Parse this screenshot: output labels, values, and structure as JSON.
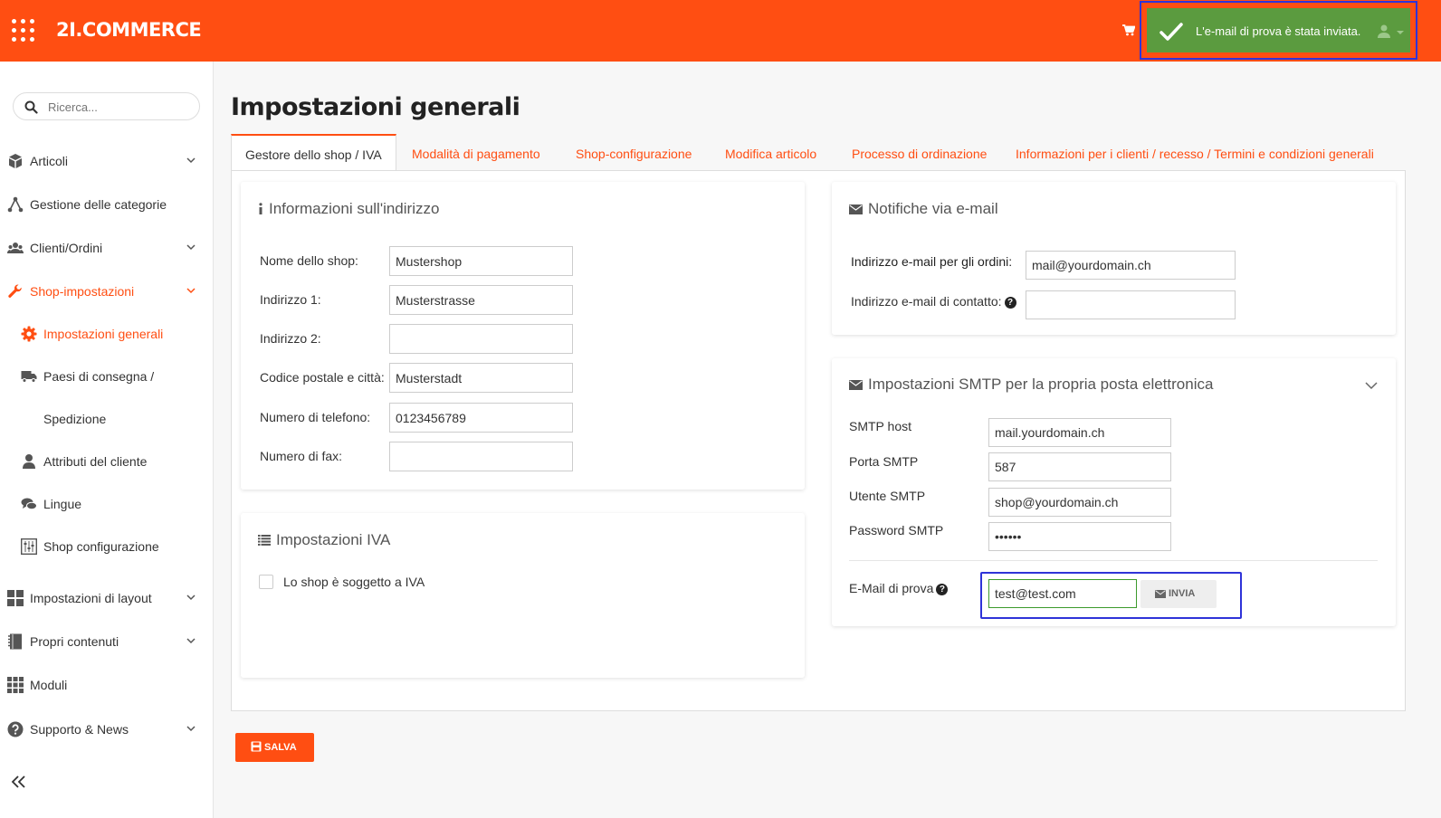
{
  "header": {
    "logo": "2I.COMMERCE",
    "toast_message": "L'e-mail di prova è stata inviata."
  },
  "sidebar": {
    "search_placeholder": "Ricerca...",
    "items": [
      {
        "label": "Articoli",
        "icon": "box-icon"
      },
      {
        "label": "Gestione delle categorie",
        "icon": "sitemap-icon"
      },
      {
        "label": "Clienti/Ordini",
        "icon": "users-icon"
      },
      {
        "label": "Shop-impostazioni",
        "icon": "wrench-icon"
      },
      {
        "label": "Impostazioni generali",
        "icon": "gear-icon"
      },
      {
        "label": "Paesi di consegna /",
        "icon": "truck-icon"
      },
      {
        "label": "Spedizione"
      },
      {
        "label": "Attributi del cliente",
        "icon": "user-icon"
      },
      {
        "label": "Lingue",
        "icon": "comments-icon"
      },
      {
        "label": "Shop configurazione",
        "icon": "sliders-icon"
      },
      {
        "label": "Impostazioni di layout",
        "icon": "grid-icon"
      },
      {
        "label": "Propri contenuti",
        "icon": "book-icon"
      },
      {
        "label": "Moduli",
        "icon": "modules-icon"
      },
      {
        "label": "Supporto & News",
        "icon": "help-icon"
      }
    ]
  },
  "page": {
    "title": "Impostazioni generali"
  },
  "tabs": [
    "Gestore dello shop / IVA",
    "Modalità di pagamento",
    "Shop-configurazione",
    "Modifica articolo",
    "Processo di ordinazione",
    "Informazioni per i clienti / recesso / Termini e condizioni generali"
  ],
  "address": {
    "title": "Informazioni sull'indirizzo",
    "fields": [
      {
        "label": "Nome dello shop:",
        "value": "Mustershop"
      },
      {
        "label": "Indirizzo 1:",
        "value": "Musterstrasse"
      },
      {
        "label": "Indirizzo 2:",
        "value": ""
      },
      {
        "label": "Codice postale e città:",
        "value": "Musterstadt"
      },
      {
        "label": "Numero di telefono:",
        "value": "0123456789"
      },
      {
        "label": "Numero di fax:",
        "value": ""
      }
    ]
  },
  "vat": {
    "title": "Impostazioni IVA",
    "checkbox_label": "Lo shop è soggetto a IVA",
    "checked": false
  },
  "email": {
    "title": "Notifiche via e-mail",
    "orders_label": "Indirizzo e-mail per gli ordini:",
    "orders_value": "mail@yourdomain.ch",
    "contact_label": "Indirizzo e-mail di contatto:",
    "contact_value": ""
  },
  "smtp": {
    "title": "Impostazioni SMTP per la propria posta elettronica",
    "host_label": "SMTP host",
    "host_value": "mail.yourdomain.ch",
    "port_label": "Porta SMTP",
    "port_value": "587",
    "user_label": "Utente SMTP",
    "user_value": "shop@yourdomain.ch",
    "password_label": "Password SMTP",
    "password_value": "••••••",
    "test_label": "E-Mail di prova",
    "test_value": "test@test.com",
    "send_label": "INVIA"
  },
  "save_label": "SALVA",
  "colors": {
    "brand": "#ff4e12",
    "success": "#5b9b3f",
    "highlight": "#2f33d8"
  }
}
